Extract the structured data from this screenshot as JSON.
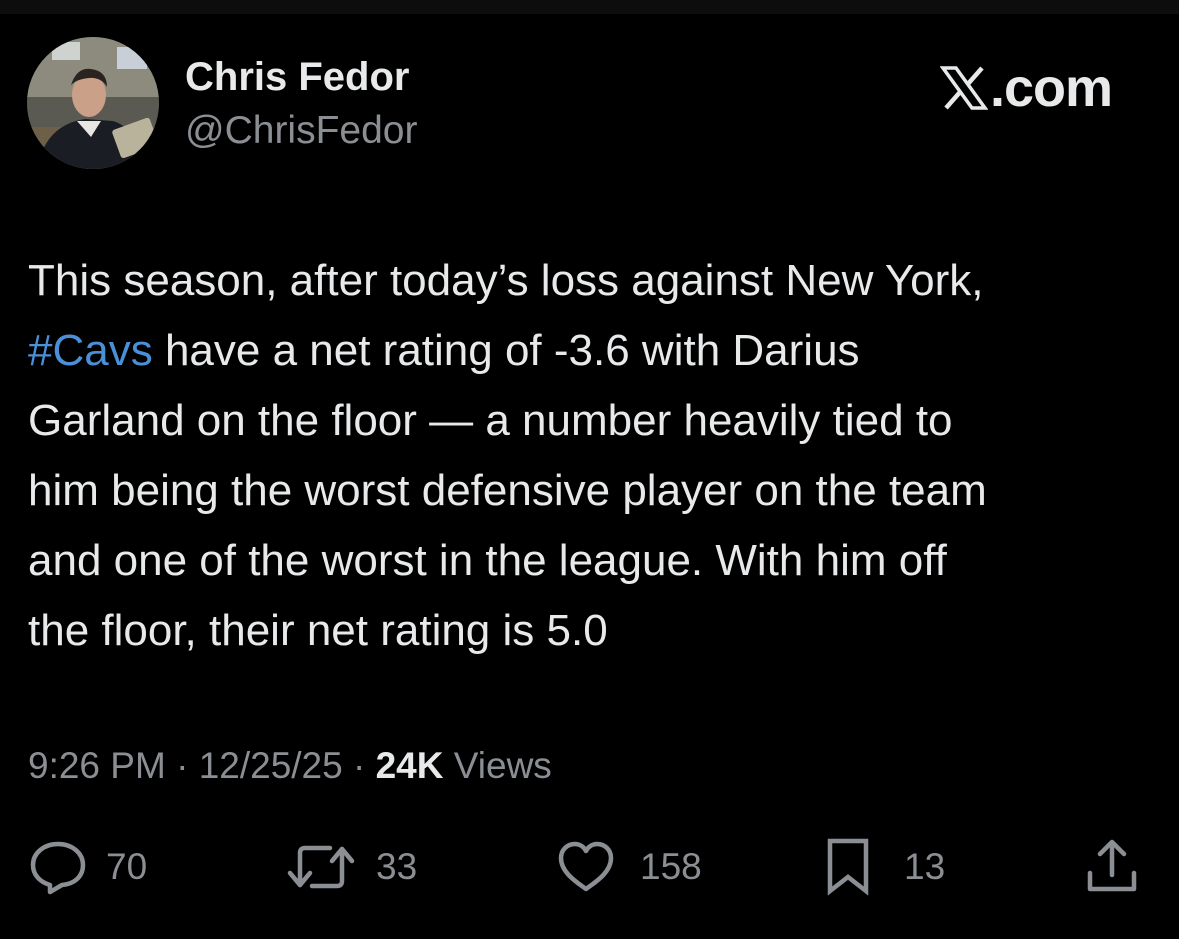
{
  "author": {
    "display_name": "Chris Fedor",
    "handle": "@ChrisFedor"
  },
  "brand": {
    "label": ".com",
    "icon": "x-logo-icon"
  },
  "tweet": {
    "lines": [
      "This season, after today’s loss against New York,",
      "have a net rating of -3.6 with Darius",
      "Garland on the floor — a number heavily tied to",
      "him being the worst defensive player on the team",
      "and one of the worst in the league. With him off",
      "the floor, their net rating is 5.0"
    ],
    "hashtag": "#Cavs",
    "hashtag_color": "#4a90d9"
  },
  "meta": {
    "time": "9:26 PM",
    "separator": "·",
    "date": "12/25/25",
    "views_count": "24K",
    "views_label": "Views"
  },
  "actions": {
    "replies": {
      "count": "70",
      "icon": "reply-icon"
    },
    "reposts": {
      "count": "33",
      "icon": "repost-icon"
    },
    "likes": {
      "count": "158",
      "icon": "heart-icon"
    },
    "bookmarks": {
      "count": "13",
      "icon": "bookmark-icon"
    },
    "share": {
      "icon": "share-icon"
    }
  },
  "colors": {
    "background": "#000000",
    "text_primary": "#e7e9ea",
    "text_secondary": "#8b8f93",
    "link": "#4a90d9"
  }
}
